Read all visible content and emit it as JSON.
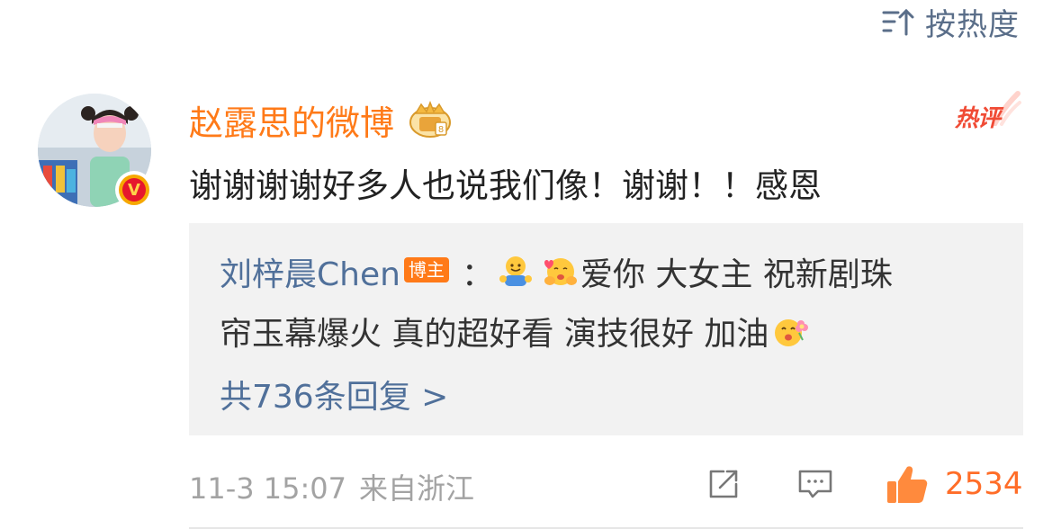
{
  "sort": {
    "label": "按热度",
    "icon": "sort-lines-icon"
  },
  "comment": {
    "username": "赵露思的微博",
    "vip_icon": "vip-crown-icon",
    "avatar_badge": "V",
    "hot_tag": "热评",
    "text": "谢谢谢谢好多人也说我们像！谢谢！！感恩"
  },
  "reply": {
    "author": "刘梓晨Chen",
    "role": "博主",
    "separator": "：",
    "line1_text": "爱你 大女主 祝新剧珠",
    "line2_text": "帘玉幕爆火 真的超好看 演技很好 加油",
    "emojis": [
      "hug-emoji",
      "love-hug-emoji",
      "flower-face-emoji"
    ],
    "more_label": "共736条回复 >"
  },
  "footer": {
    "time": "11-3 15:07",
    "source": "来自浙江",
    "like_count": "2534"
  },
  "colors": {
    "accent_orange": "#ff7a18",
    "link_blue": "#50709a",
    "like_orange": "#ff6d28",
    "hot_red": "#f04b35",
    "reply_bg": "#f2f2f2"
  }
}
